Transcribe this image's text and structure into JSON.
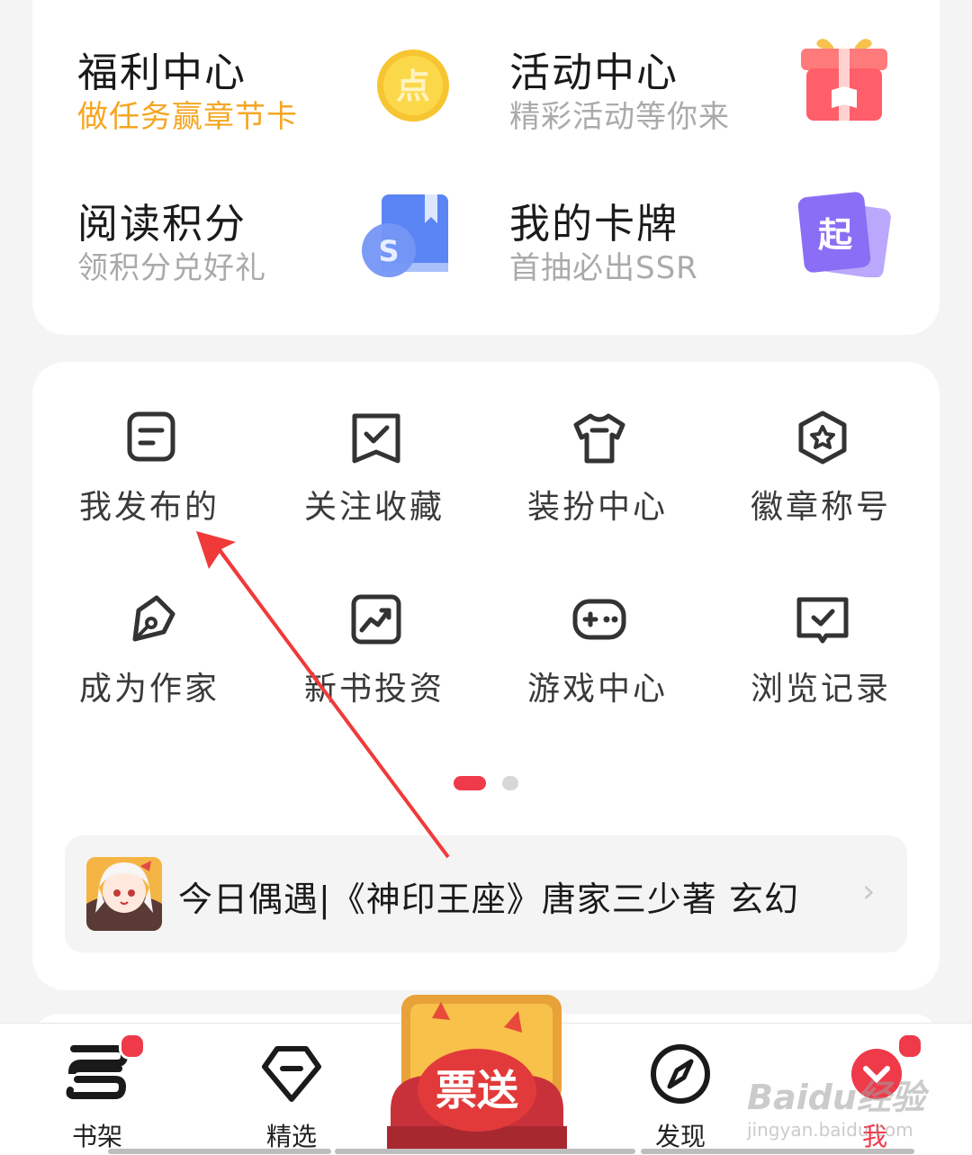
{
  "features": [
    {
      "title": "福利中心",
      "subtitle": "做任务赢章节卡",
      "icon": "gold-coin-icon",
      "icon_glyph": "点"
    },
    {
      "title": "活动中心",
      "subtitle": "精彩活动等你来",
      "icon": "gift-box-icon"
    },
    {
      "title": "阅读积分",
      "subtitle": "领积分兑好礼",
      "icon": "book-points-icon",
      "icon_glyph": "S"
    },
    {
      "title": "我的卡牌",
      "subtitle": "首抽必出SSR",
      "icon": "cards-icon",
      "icon_glyph": "起"
    }
  ],
  "grid": [
    {
      "label": "我发布的",
      "icon": "document-icon"
    },
    {
      "label": "关注收藏",
      "icon": "bookmark-check-icon"
    },
    {
      "label": "装扮中心",
      "icon": "tshirt-icon"
    },
    {
      "label": "徽章称号",
      "icon": "badge-star-icon"
    },
    {
      "label": "成为作家",
      "icon": "pen-icon"
    },
    {
      "label": "新书投资",
      "icon": "trend-chart-icon"
    },
    {
      "label": "游戏中心",
      "icon": "gamepad-icon"
    },
    {
      "label": "浏览记录",
      "icon": "history-book-icon"
    }
  ],
  "pagination": {
    "pages": 2,
    "current": 1
  },
  "banner": {
    "text": "今日偶遇|《神印王座》唐家三少著 玄幻",
    "chevron": "›"
  },
  "tabs": [
    {
      "label": "书架",
      "icon": "bookshelf-icon",
      "badge": true
    },
    {
      "label": "精选",
      "icon": "diamond-icon",
      "badge": false
    },
    {
      "label": "",
      "icon": "promo-ticket-icon",
      "promo_text": "票送"
    },
    {
      "label": "发现",
      "icon": "compass-icon",
      "badge": false
    },
    {
      "label": "我",
      "icon": "profile-icon",
      "badge": true,
      "active": true
    }
  ],
  "watermark": {
    "line1": "Baidu经验",
    "line2": "jingyan.baidu.com"
  },
  "colors": {
    "accent": "#ef3a4a",
    "orange": "#f5a623",
    "annotation_arrow": "#f03a3a"
  }
}
